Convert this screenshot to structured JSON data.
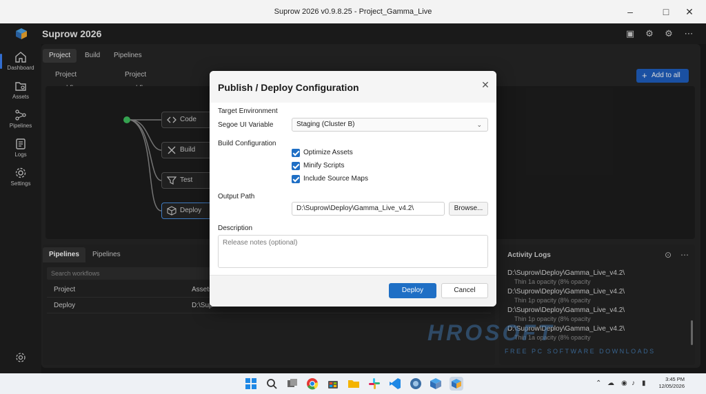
{
  "window": {
    "title": "Suprow 2026 v0.9.8.25 - Project_Gamma_Live"
  },
  "app": {
    "name": "Suprow 2026"
  },
  "nav": [
    {
      "label": "Dashboard",
      "icon": "home-icon"
    },
    {
      "label": "Assets",
      "icon": "assets-icon"
    },
    {
      "label": "Pipelines",
      "icon": "pipelines-icon"
    },
    {
      "label": "Logs",
      "icon": "logs-icon"
    },
    {
      "label": "Settings",
      "icon": "settings-icon"
    }
  ],
  "tabs": [
    "Project",
    "Build",
    "Pipelines"
  ],
  "subbar": {
    "workflows": "Project workflows",
    "dropdown": "Project workfless",
    "add_button": "Add to all"
  },
  "nodes": [
    "Code",
    "Build",
    "Test",
    "Deploy"
  ],
  "bottom": {
    "tabs": [
      "Pipelines",
      "Pipelines"
    ],
    "search_placeholder": "Search workflows",
    "rows": [
      {
        "name": "Project",
        "col2": "Assets"
      },
      {
        "name": "Deploy",
        "col2": "D:\\Sup"
      }
    ]
  },
  "activity": {
    "title": "Activity Logs",
    "entries": [
      {
        "path": "D:\\Suprow\\Deploy\\Gamma_Live_v4.2\\",
        "sub": "Thin 1a opacity (8% opacity"
      },
      {
        "path": "D:\\Suprow\\Deploy\\Gamma_Live_v4.2\\",
        "sub": "Thin 1p opacity (8% opacity"
      },
      {
        "path": "D:\\Suprow\\Deploy\\Gamma_Live_v4.2\\",
        "sub": "Thin 1p opacity (8% opacity"
      },
      {
        "path": "D:\\Suprow\\Deploy\\Gamma_Live_v4.2\\",
        "sub": "Thin 1a opacity (8% opacity"
      }
    ]
  },
  "modal": {
    "title": "Publish / Deploy Configuration",
    "target_env_label": "Target Environment",
    "font_label": "Segoe UI Variable",
    "env_value": "Staging (Cluster B)",
    "build_config_label": "Build Configuration",
    "checkboxes": [
      {
        "label": "Optimize Assets",
        "checked": true
      },
      {
        "label": "Minify Scripts",
        "checked": true
      },
      {
        "label": "Include Source Maps",
        "checked": true
      }
    ],
    "output_label": "Output Path",
    "output_value": "D:\\Suprow\\Deploy\\Gamma_Live_v4.2\\",
    "browse_label": "Browse...",
    "description_label": "Description",
    "description_placeholder": "Release notes (optional)",
    "deploy_label": "Deploy",
    "cancel_label": "Cancel"
  },
  "watermark": {
    "big": "HROSOFT",
    "small": "FREE PC SOFTWARE DOWNLOADS"
  },
  "taskbar": {
    "time": "3:45 PM",
    "date": "12/05/2026"
  },
  "colors": {
    "accent": "#1f6fc5",
    "window_bg": "#1b1b1b",
    "panel_bg": "#262626"
  }
}
